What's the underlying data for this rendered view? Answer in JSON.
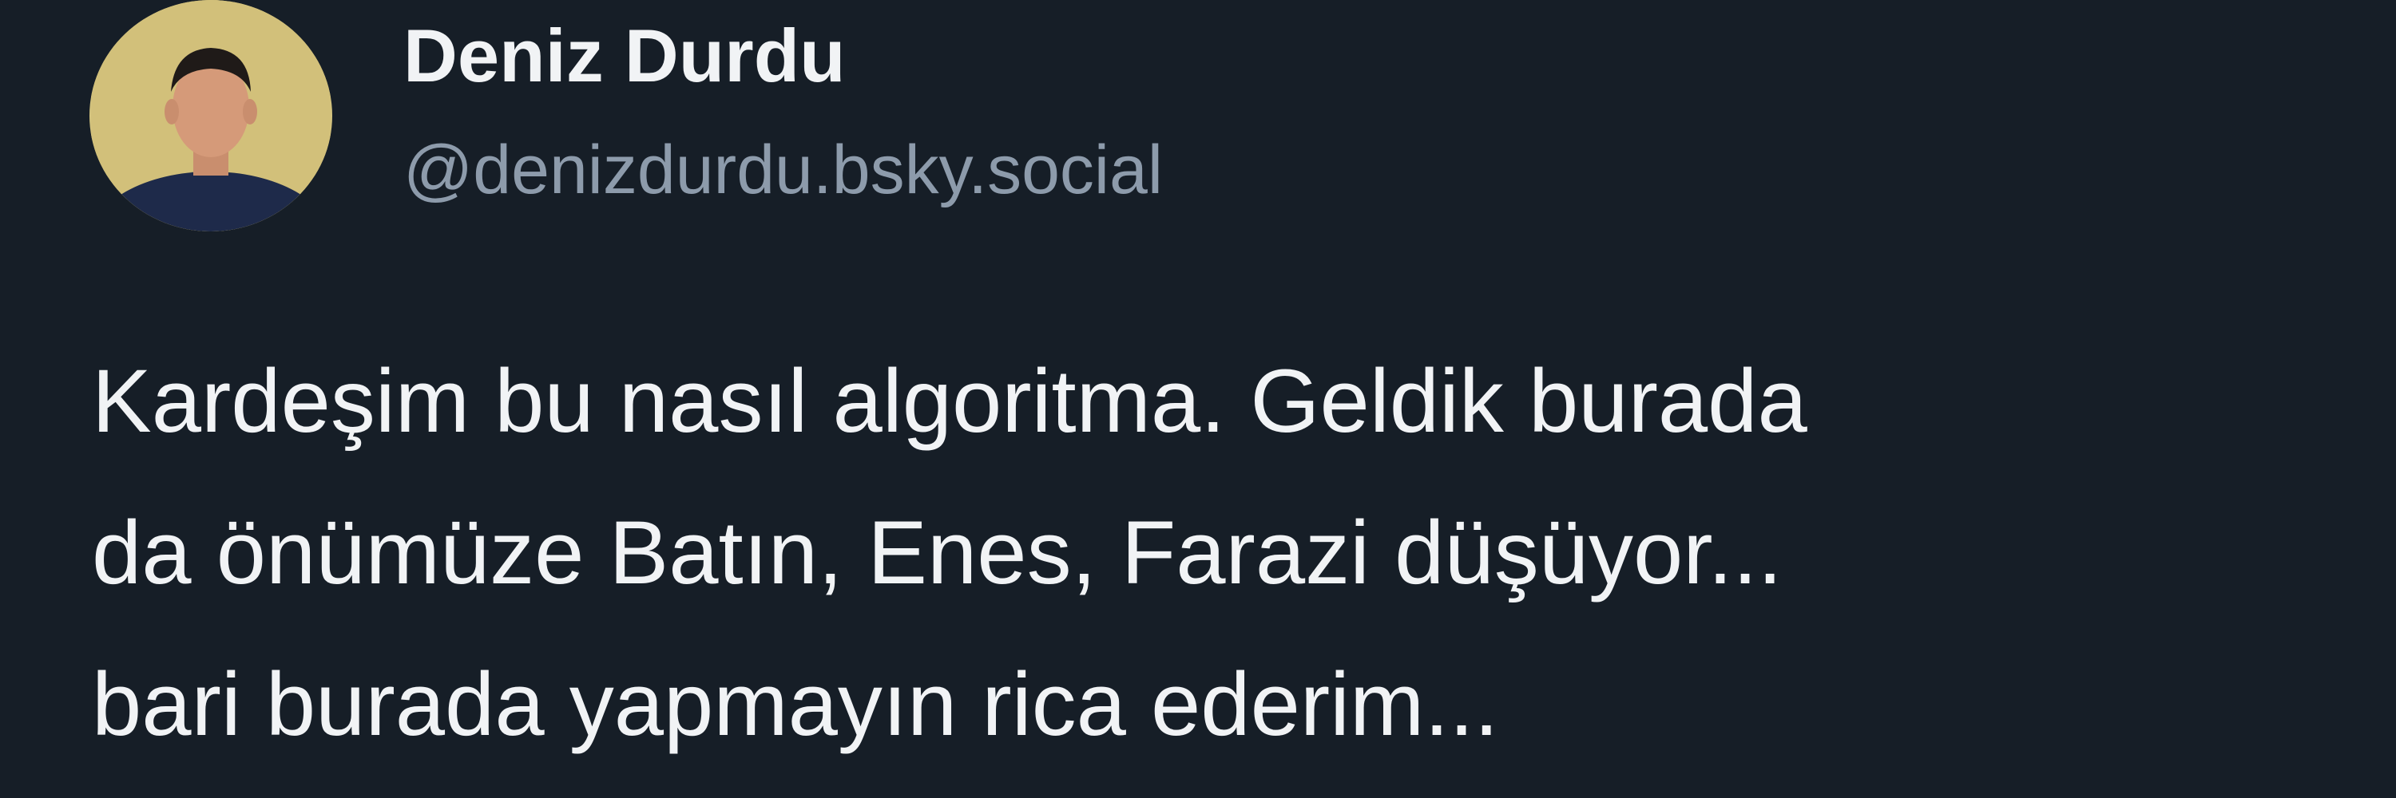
{
  "post": {
    "author": {
      "name": "Deniz Durdu",
      "handle": "@denizdurdu.bsky.social",
      "avatar_icon": "avatar-photo"
    },
    "text_lines": [
      "Kardeşim bu nasıl algoritma. Geldik burada",
      "da önümüze Batın, Enes, Farazi düşüyor...",
      "bari burada yapmayın rica ederim..."
    ]
  },
  "colors": {
    "background": "#161e27",
    "name": "#f1f3f5",
    "handle": "#8d9bab",
    "text": "#f1f3f5"
  }
}
